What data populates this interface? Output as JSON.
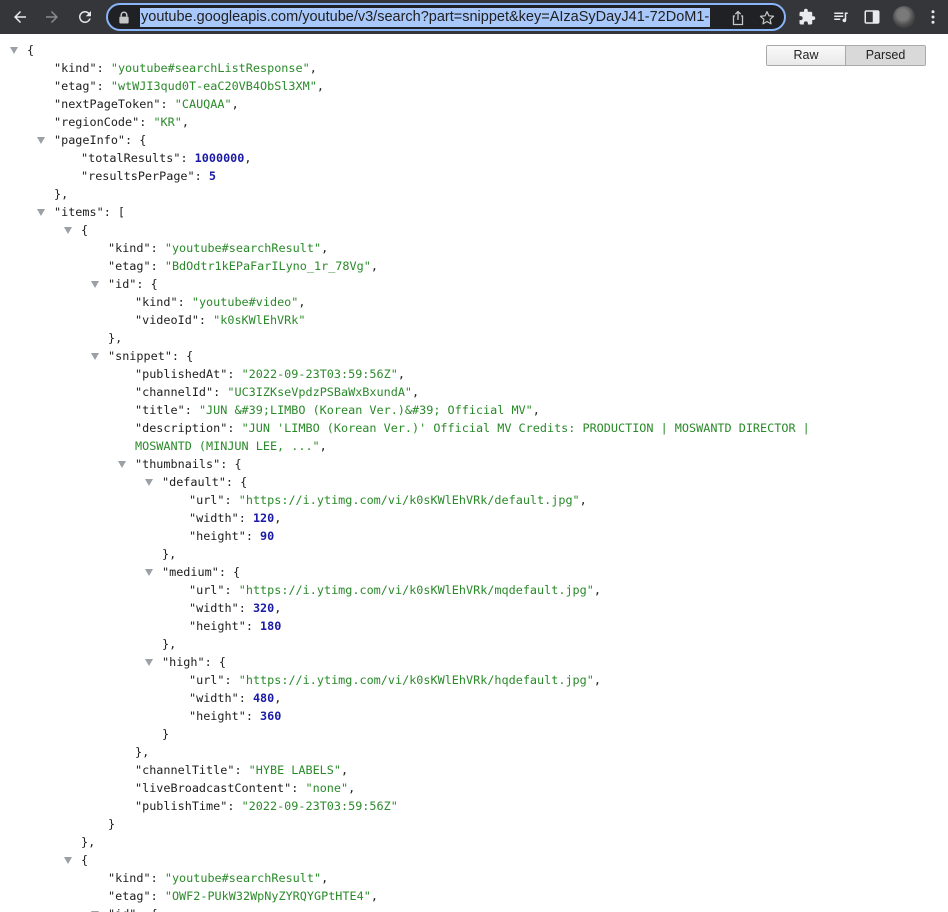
{
  "browser": {
    "url": "youtube.googleapis.com/youtube/v3/search?part=snippet&key=AIzaSyDayJ41-72DoM1-"
  },
  "viewer": {
    "raw_label": "Raw",
    "parsed_label": "Parsed"
  },
  "json_lines": [
    {
      "indent": 0,
      "tri": true,
      "tokens": [
        {
          "t": "p",
          "v": "{"
        }
      ]
    },
    {
      "indent": 1,
      "tokens": [
        {
          "t": "k",
          "v": "\"kind\""
        },
        {
          "t": "p",
          "v": ": "
        },
        {
          "t": "s",
          "v": "\"youtube#searchListResponse\""
        },
        {
          "t": "p",
          "v": ","
        }
      ]
    },
    {
      "indent": 1,
      "tokens": [
        {
          "t": "k",
          "v": "\"etag\""
        },
        {
          "t": "p",
          "v": ": "
        },
        {
          "t": "s",
          "v": "\"wtWJI3qud0T-eaC20VB4ObSl3XM\""
        },
        {
          "t": "p",
          "v": ","
        }
      ]
    },
    {
      "indent": 1,
      "tokens": [
        {
          "t": "k",
          "v": "\"nextPageToken\""
        },
        {
          "t": "p",
          "v": ": "
        },
        {
          "t": "s",
          "v": "\"CAUQAA\""
        },
        {
          "t": "p",
          "v": ","
        }
      ]
    },
    {
      "indent": 1,
      "tokens": [
        {
          "t": "k",
          "v": "\"regionCode\""
        },
        {
          "t": "p",
          "v": ": "
        },
        {
          "t": "s",
          "v": "\"KR\""
        },
        {
          "t": "p",
          "v": ","
        }
      ]
    },
    {
      "indent": 1,
      "tri": true,
      "tokens": [
        {
          "t": "k",
          "v": "\"pageInfo\""
        },
        {
          "t": "p",
          "v": ": {"
        }
      ]
    },
    {
      "indent": 2,
      "tokens": [
        {
          "t": "k",
          "v": "\"totalResults\""
        },
        {
          "t": "p",
          "v": ": "
        },
        {
          "t": "n",
          "v": "1000000"
        },
        {
          "t": "p",
          "v": ","
        }
      ]
    },
    {
      "indent": 2,
      "tokens": [
        {
          "t": "k",
          "v": "\"resultsPerPage\""
        },
        {
          "t": "p",
          "v": ": "
        },
        {
          "t": "n",
          "v": "5"
        }
      ]
    },
    {
      "indent": 1,
      "tokens": [
        {
          "t": "p",
          "v": "},"
        }
      ]
    },
    {
      "indent": 1,
      "tri": true,
      "tokens": [
        {
          "t": "k",
          "v": "\"items\""
        },
        {
          "t": "p",
          "v": ": ["
        }
      ]
    },
    {
      "indent": 2,
      "tri": true,
      "tokens": [
        {
          "t": "p",
          "v": "{"
        }
      ]
    },
    {
      "indent": 3,
      "tokens": [
        {
          "t": "k",
          "v": "\"kind\""
        },
        {
          "t": "p",
          "v": ": "
        },
        {
          "t": "s",
          "v": "\"youtube#searchResult\""
        },
        {
          "t": "p",
          "v": ","
        }
      ]
    },
    {
      "indent": 3,
      "tokens": [
        {
          "t": "k",
          "v": "\"etag\""
        },
        {
          "t": "p",
          "v": ": "
        },
        {
          "t": "s",
          "v": "\"BdOdtr1kEPaFarILyno_1r_78Vg\""
        },
        {
          "t": "p",
          "v": ","
        }
      ]
    },
    {
      "indent": 3,
      "tri": true,
      "tokens": [
        {
          "t": "k",
          "v": "\"id\""
        },
        {
          "t": "p",
          "v": ": {"
        }
      ]
    },
    {
      "indent": 4,
      "tokens": [
        {
          "t": "k",
          "v": "\"kind\""
        },
        {
          "t": "p",
          "v": ": "
        },
        {
          "t": "s",
          "v": "\"youtube#video\""
        },
        {
          "t": "p",
          "v": ","
        }
      ]
    },
    {
      "indent": 4,
      "tokens": [
        {
          "t": "k",
          "v": "\"videoId\""
        },
        {
          "t": "p",
          "v": ": "
        },
        {
          "t": "s",
          "v": "\"k0sKWlEhVRk\""
        }
      ]
    },
    {
      "indent": 3,
      "tokens": [
        {
          "t": "p",
          "v": "},"
        }
      ]
    },
    {
      "indent": 3,
      "tri": true,
      "tokens": [
        {
          "t": "k",
          "v": "\"snippet\""
        },
        {
          "t": "p",
          "v": ": {"
        }
      ]
    },
    {
      "indent": 4,
      "tokens": [
        {
          "t": "k",
          "v": "\"publishedAt\""
        },
        {
          "t": "p",
          "v": ": "
        },
        {
          "t": "s",
          "v": "\"2022-09-23T03:59:56Z\""
        },
        {
          "t": "p",
          "v": ","
        }
      ]
    },
    {
      "indent": 4,
      "tokens": [
        {
          "t": "k",
          "v": "\"channelId\""
        },
        {
          "t": "p",
          "v": ": "
        },
        {
          "t": "s",
          "v": "\"UC3IZKseVpdzPSBaWxBxundA\""
        },
        {
          "t": "p",
          "v": ","
        }
      ]
    },
    {
      "indent": 4,
      "tokens": [
        {
          "t": "k",
          "v": "\"title\""
        },
        {
          "t": "p",
          "v": ": "
        },
        {
          "t": "s",
          "v": "\"JUN &#39;LIMBO (Korean Ver.)&#39; Official MV\""
        },
        {
          "t": "p",
          "v": ","
        }
      ]
    },
    {
      "indent": 4,
      "tokens": [
        {
          "t": "k",
          "v": "\"description\""
        },
        {
          "t": "p",
          "v": ": "
        },
        {
          "t": "s",
          "v": "\"JUN 'LIMBO (Korean Ver.)' Official MV Credits: PRODUCTION | MOSWANTD DIRECTOR |"
        }
      ]
    },
    {
      "indent": 4,
      "tokens": [
        {
          "t": "s",
          "v": "MOSWANTD (MINJUN LEE, ...\""
        },
        {
          "t": "p",
          "v": ","
        }
      ]
    },
    {
      "indent": 4,
      "tri": true,
      "tokens": [
        {
          "t": "k",
          "v": "\"thumbnails\""
        },
        {
          "t": "p",
          "v": ": {"
        }
      ]
    },
    {
      "indent": 5,
      "tri": true,
      "tokens": [
        {
          "t": "k",
          "v": "\"default\""
        },
        {
          "t": "p",
          "v": ": {"
        }
      ]
    },
    {
      "indent": 6,
      "tokens": [
        {
          "t": "k",
          "v": "\"url\""
        },
        {
          "t": "p",
          "v": ": "
        },
        {
          "t": "s",
          "v": "\"https://i.ytimg.com/vi/k0sKWlEhVRk/default.jpg\""
        },
        {
          "t": "p",
          "v": ","
        }
      ]
    },
    {
      "indent": 6,
      "tokens": [
        {
          "t": "k",
          "v": "\"width\""
        },
        {
          "t": "p",
          "v": ": "
        },
        {
          "t": "n",
          "v": "120"
        },
        {
          "t": "p",
          "v": ","
        }
      ]
    },
    {
      "indent": 6,
      "tokens": [
        {
          "t": "k",
          "v": "\"height\""
        },
        {
          "t": "p",
          "v": ": "
        },
        {
          "t": "n",
          "v": "90"
        }
      ]
    },
    {
      "indent": 5,
      "tokens": [
        {
          "t": "p",
          "v": "},"
        }
      ]
    },
    {
      "indent": 5,
      "tri": true,
      "tokens": [
        {
          "t": "k",
          "v": "\"medium\""
        },
        {
          "t": "p",
          "v": ": {"
        }
      ]
    },
    {
      "indent": 6,
      "tokens": [
        {
          "t": "k",
          "v": "\"url\""
        },
        {
          "t": "p",
          "v": ": "
        },
        {
          "t": "s",
          "v": "\"https://i.ytimg.com/vi/k0sKWlEhVRk/mqdefault.jpg\""
        },
        {
          "t": "p",
          "v": ","
        }
      ]
    },
    {
      "indent": 6,
      "tokens": [
        {
          "t": "k",
          "v": "\"width\""
        },
        {
          "t": "p",
          "v": ": "
        },
        {
          "t": "n",
          "v": "320"
        },
        {
          "t": "p",
          "v": ","
        }
      ]
    },
    {
      "indent": 6,
      "tokens": [
        {
          "t": "k",
          "v": "\"height\""
        },
        {
          "t": "p",
          "v": ": "
        },
        {
          "t": "n",
          "v": "180"
        }
      ]
    },
    {
      "indent": 5,
      "tokens": [
        {
          "t": "p",
          "v": "},"
        }
      ]
    },
    {
      "indent": 5,
      "tri": true,
      "tokens": [
        {
          "t": "k",
          "v": "\"high\""
        },
        {
          "t": "p",
          "v": ": {"
        }
      ]
    },
    {
      "indent": 6,
      "tokens": [
        {
          "t": "k",
          "v": "\"url\""
        },
        {
          "t": "p",
          "v": ": "
        },
        {
          "t": "s",
          "v": "\"https://i.ytimg.com/vi/k0sKWlEhVRk/hqdefault.jpg\""
        },
        {
          "t": "p",
          "v": ","
        }
      ]
    },
    {
      "indent": 6,
      "tokens": [
        {
          "t": "k",
          "v": "\"width\""
        },
        {
          "t": "p",
          "v": ": "
        },
        {
          "t": "n",
          "v": "480"
        },
        {
          "t": "p",
          "v": ","
        }
      ]
    },
    {
      "indent": 6,
      "tokens": [
        {
          "t": "k",
          "v": "\"height\""
        },
        {
          "t": "p",
          "v": ": "
        },
        {
          "t": "n",
          "v": "360"
        }
      ]
    },
    {
      "indent": 5,
      "tokens": [
        {
          "t": "p",
          "v": "}"
        }
      ]
    },
    {
      "indent": 4,
      "tokens": [
        {
          "t": "p",
          "v": "},"
        }
      ]
    },
    {
      "indent": 4,
      "tokens": [
        {
          "t": "k",
          "v": "\"channelTitle\""
        },
        {
          "t": "p",
          "v": ": "
        },
        {
          "t": "s",
          "v": "\"HYBE LABELS\""
        },
        {
          "t": "p",
          "v": ","
        }
      ]
    },
    {
      "indent": 4,
      "tokens": [
        {
          "t": "k",
          "v": "\"liveBroadcastContent\""
        },
        {
          "t": "p",
          "v": ": "
        },
        {
          "t": "s",
          "v": "\"none\""
        },
        {
          "t": "p",
          "v": ","
        }
      ]
    },
    {
      "indent": 4,
      "tokens": [
        {
          "t": "k",
          "v": "\"publishTime\""
        },
        {
          "t": "p",
          "v": ": "
        },
        {
          "t": "s",
          "v": "\"2022-09-23T03:59:56Z\""
        }
      ]
    },
    {
      "indent": 3,
      "tokens": [
        {
          "t": "p",
          "v": "}"
        }
      ]
    },
    {
      "indent": 2,
      "tokens": [
        {
          "t": "p",
          "v": "},"
        }
      ]
    },
    {
      "indent": 2,
      "tri": true,
      "tokens": [
        {
          "t": "p",
          "v": "{"
        }
      ]
    },
    {
      "indent": 3,
      "tokens": [
        {
          "t": "k",
          "v": "\"kind\""
        },
        {
          "t": "p",
          "v": ": "
        },
        {
          "t": "s",
          "v": "\"youtube#searchResult\""
        },
        {
          "t": "p",
          "v": ","
        }
      ]
    },
    {
      "indent": 3,
      "tokens": [
        {
          "t": "k",
          "v": "\"etag\""
        },
        {
          "t": "p",
          "v": ": "
        },
        {
          "t": "s",
          "v": "\"OWF2-PUkW32WpNyZYRQYGPtHTE4\""
        },
        {
          "t": "p",
          "v": ","
        }
      ]
    },
    {
      "indent": 3,
      "tri": true,
      "tokens": [
        {
          "t": "k",
          "v": "\"id\""
        },
        {
          "t": "p",
          "v": ": {"
        }
      ]
    }
  ]
}
